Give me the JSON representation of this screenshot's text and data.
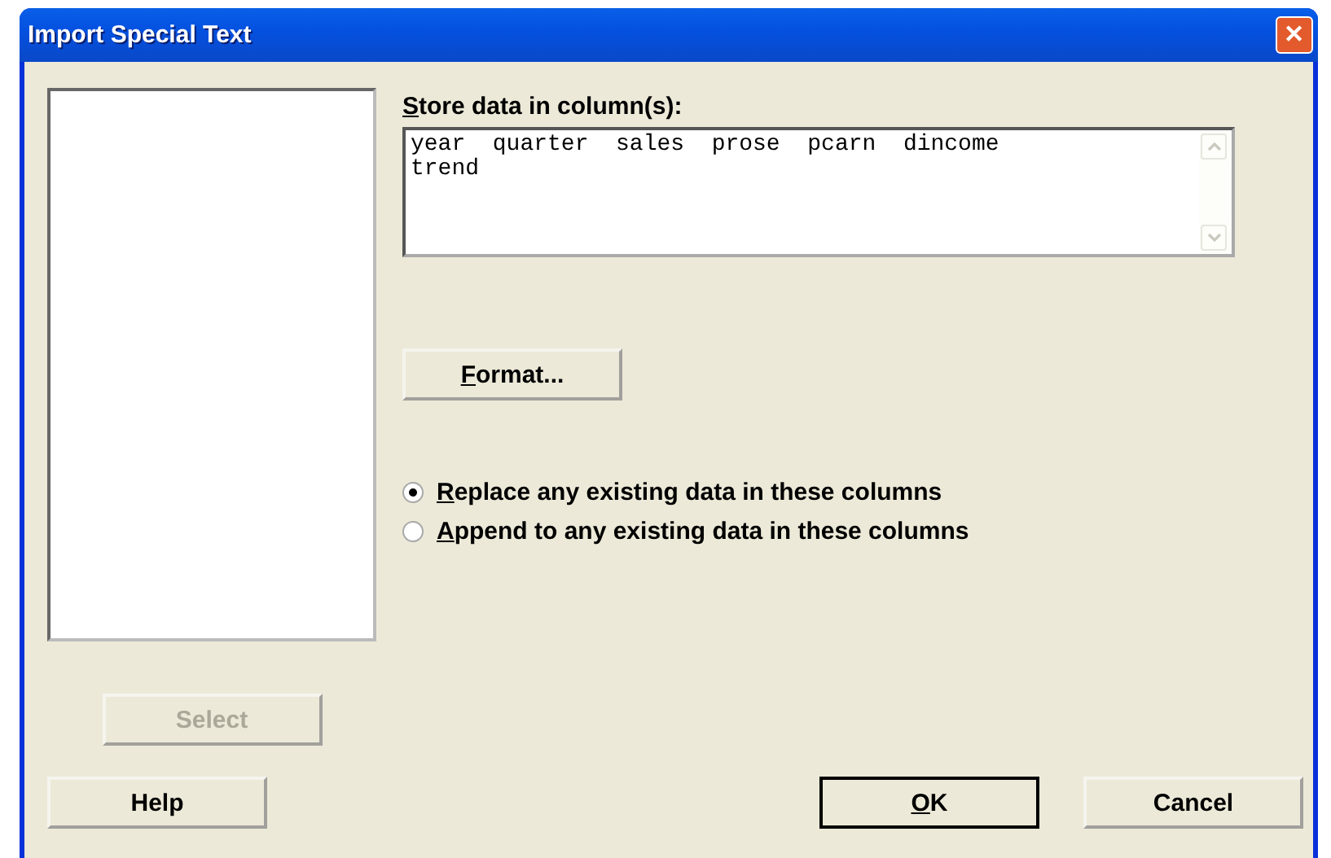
{
  "window": {
    "title": "Import Special Text",
    "close": "✕"
  },
  "store_field": {
    "label_key": "S",
    "label_rest": "tore data in column(s):",
    "value": "year  quarter  sales  prose  pcarn  dincome\ntrend"
  },
  "format_button": {
    "key": "F",
    "rest": "ormat..."
  },
  "options": [
    {
      "key": "R",
      "rest": "eplace any existing data in these columns",
      "selected": true
    },
    {
      "key": "A",
      "rest": "ppend to any existing data in these columns",
      "selected": false
    }
  ],
  "select_button": {
    "label": "Select",
    "disabled": true
  },
  "buttons": [
    {
      "kind": "help",
      "label": "Help"
    },
    {
      "kind": "ok",
      "key": "O",
      "rest": "K",
      "default": true
    },
    {
      "kind": "cancel",
      "label": "Cancel"
    }
  ]
}
